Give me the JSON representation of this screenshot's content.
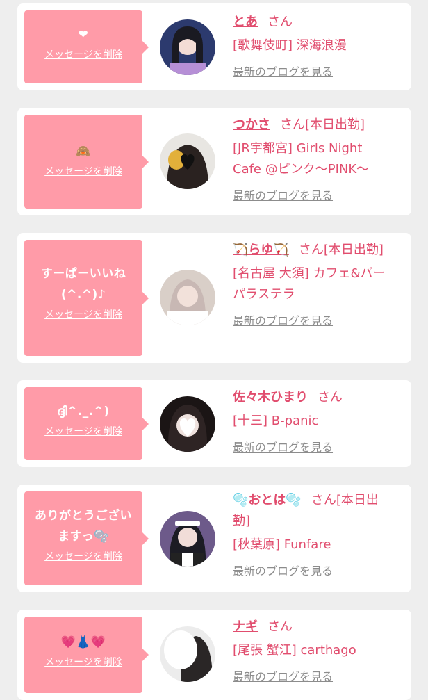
{
  "messages": [
    {
      "message": "❤",
      "delete_label": "メッセージを削除",
      "name": "とあ",
      "suffix": "さん",
      "shop": "[歌舞伎町] 深海浪漫",
      "blog_label": "最新のブログを見る"
    },
    {
      "message": "🙈",
      "delete_label": "メッセージを削除",
      "name": "つかさ",
      "suffix": "さん[本日出勤]",
      "shop": "[JR宇都宮] Girls Night Cafe @ピンク〜PINK〜",
      "blog_label": "最新のブログを見る"
    },
    {
      "message": "すーぱーいいね(^.^)♪",
      "delete_label": "メッセージを削除",
      "name": "🏹らゆ🏹",
      "suffix": "さん[本日出勤]",
      "shop": "[名古屋 大須] カフェ&バー パラステラ",
      "blog_label": "最新のブログを見る"
    },
    {
      "message": "ദ്ദി^._.^)",
      "delete_label": "メッセージを削除",
      "name": "佐々木ひまり",
      "suffix": "さん",
      "shop": "[十三] B-panic",
      "blog_label": "最新のブログを見る"
    },
    {
      "message": "ありがとうございますっ🫧",
      "delete_label": "メッセージを削除",
      "name": "🫧おとは🫧",
      "suffix": "さん[本日出勤]",
      "shop": "[秋葉原] Funfare",
      "blog_label": "最新のブログを見る"
    },
    {
      "message": "💗👗💗",
      "delete_label": "メッセージを削除",
      "name": "ナギ",
      "suffix": "さん",
      "shop": "[尾張 蟹江] carthago",
      "blog_label": "最新のブログを見る"
    }
  ]
}
